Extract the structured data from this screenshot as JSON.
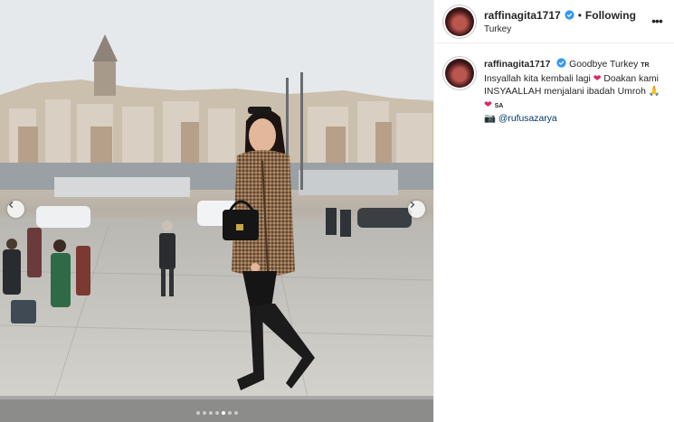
{
  "post": {
    "image_alt": "",
    "carousel": {
      "count": 7,
      "active_index": 4
    }
  },
  "header": {
    "username": "raffinagita1717",
    "separator": "•",
    "follow_label": "Following",
    "location": "Turkey",
    "more_icon": "more-options-icon"
  },
  "caption": {
    "username": "raffinagita1717",
    "text_1": "Goodbye Turkey",
    "flag_1": "TR",
    "text_2": "Insyallah kita kembali lagi",
    "heart_1": "❤",
    "text_3": "Doakan kami INSYAALLAH menjalani ibadah Umroh",
    "pray_emoji": "🙏",
    "heart_2": "❤",
    "flag_2": "SA",
    "camera_emoji": "📷",
    "mention": "@rufusazarya"
  },
  "colors": {
    "verified": "#3897f0",
    "mention": "#00376b",
    "heart": "#e0245e"
  }
}
